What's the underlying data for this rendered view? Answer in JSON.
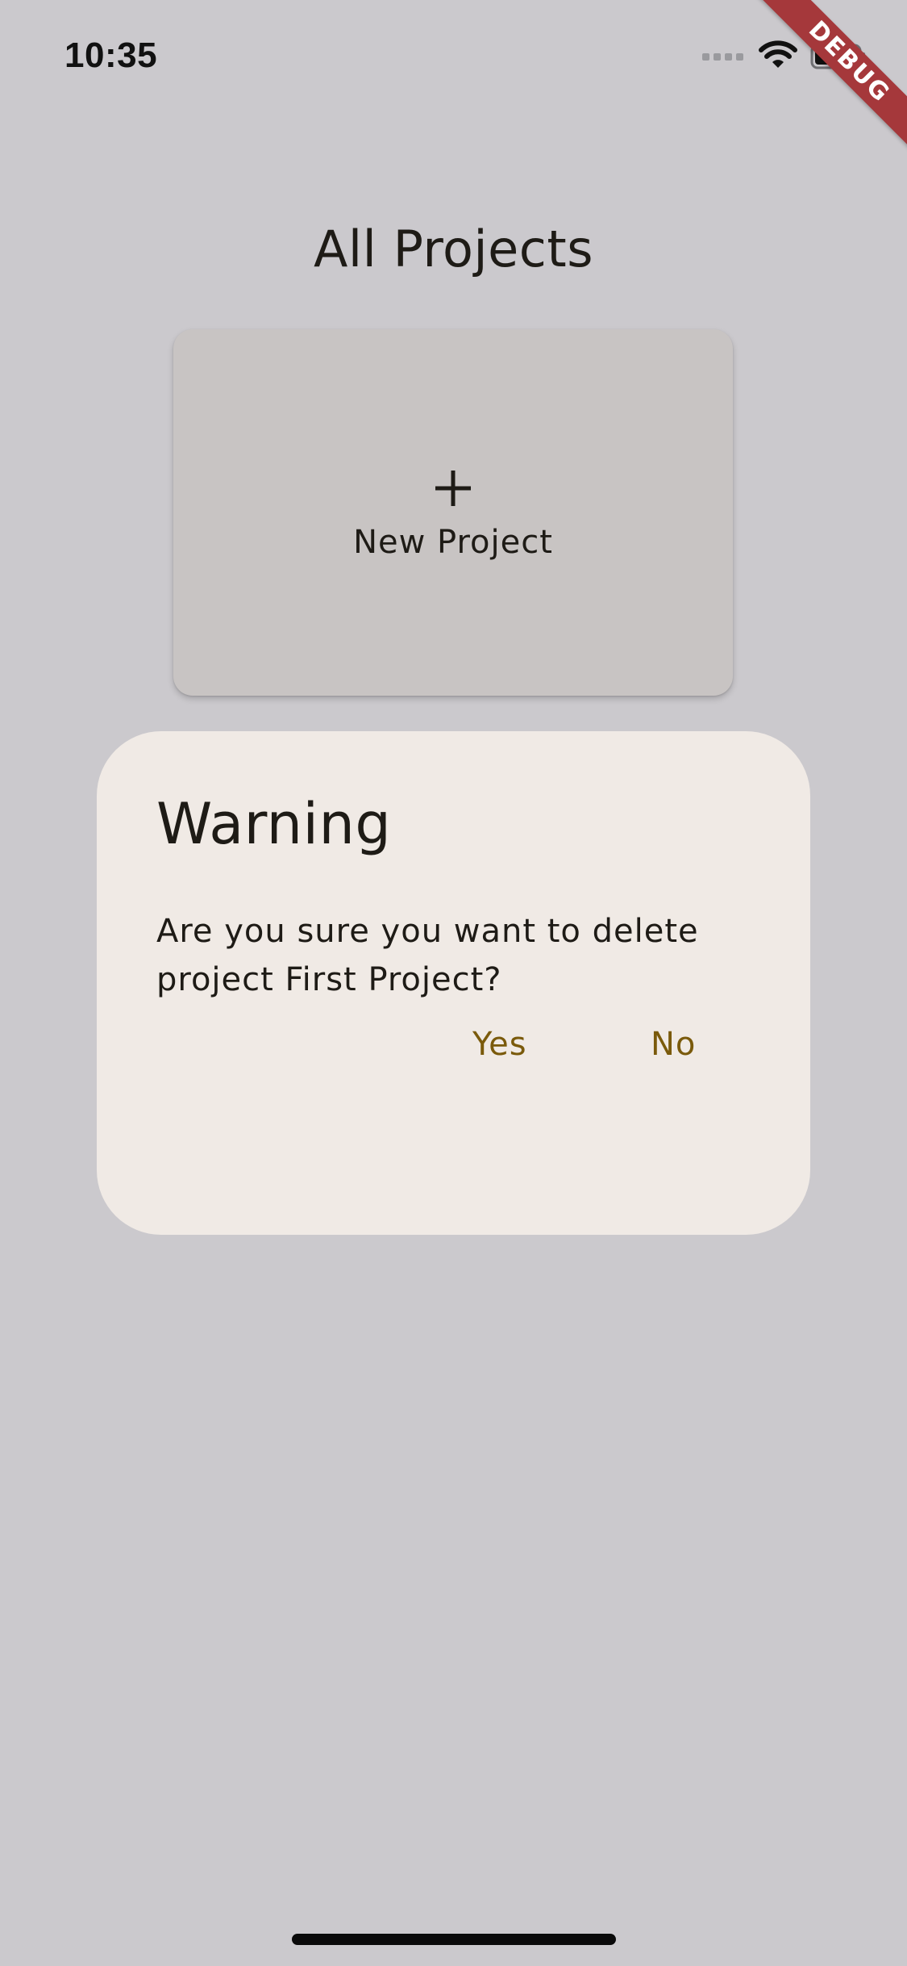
{
  "status_bar": {
    "time": "10:35",
    "icons": [
      "signal-icon",
      "wifi-icon",
      "battery-icon"
    ]
  },
  "debug_banner": {
    "label": "DEBUG",
    "color": "#a5383b"
  },
  "page": {
    "title": "All Projects",
    "background": "#cbc9cd"
  },
  "new_project_card": {
    "icon": "plus-icon",
    "label": "New Project"
  },
  "dialog": {
    "title": "Warning",
    "message": "Are you sure you want to delete project First Project?",
    "yes_label": "Yes",
    "no_label": "No",
    "button_color": "#7a5a0b",
    "background": "#f0eae5"
  }
}
